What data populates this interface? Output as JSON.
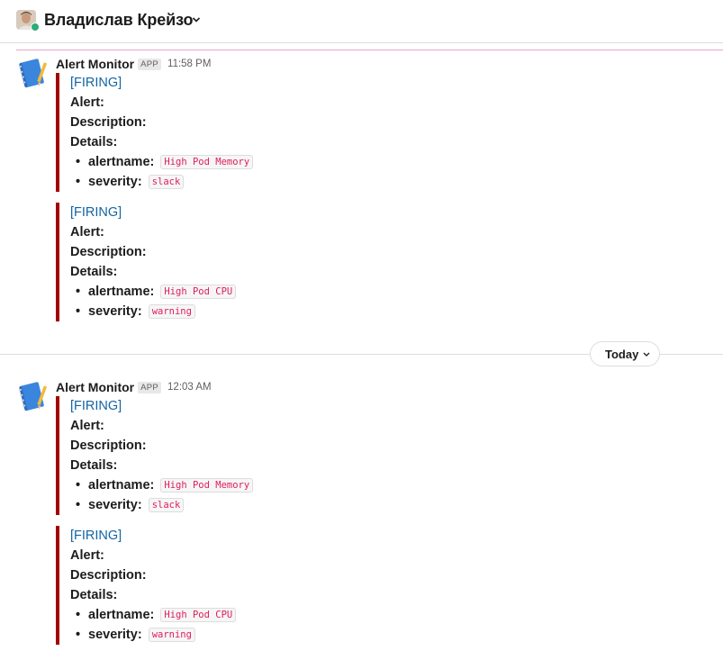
{
  "header": {
    "title": "Владислав Крейзо",
    "avatar_icon": "user-avatar",
    "chevron_icon": "chevron-down-icon"
  },
  "colors": {
    "attachment_bar": "#a30200",
    "firing_link": "#1264a3",
    "code_text": "#e01e5a",
    "presence": "#2bac76"
  },
  "day_divider": {
    "label": "Today"
  },
  "messages": [
    {
      "sender": "Alert Monitor",
      "badge": "APP",
      "time": "11:58 PM",
      "attachments": [
        {
          "title": "[FIRING]",
          "alert_label": "Alert:",
          "description_label": "Description:",
          "details_label": "Details:",
          "alertname_label": "alertname:",
          "alertname": "High Pod Memory",
          "severity_label": "severity:",
          "severity": "slack"
        },
        {
          "title": "[FIRING]",
          "alert_label": "Alert:",
          "description_label": "Description:",
          "details_label": "Details:",
          "alertname_label": "alertname:",
          "alertname": "High Pod CPU",
          "severity_label": "severity:",
          "severity": "warning"
        }
      ]
    },
    {
      "sender": "Alert Monitor",
      "badge": "APP",
      "time": "12:03 AM",
      "attachments": [
        {
          "title": "[FIRING]",
          "alert_label": "Alert:",
          "description_label": "Description:",
          "details_label": "Details:",
          "alertname_label": "alertname:",
          "alertname": "High Pod Memory",
          "severity_label": "severity:",
          "severity": "slack"
        },
        {
          "title": "[FIRING]",
          "alert_label": "Alert:",
          "description_label": "Description:",
          "details_label": "Details:",
          "alertname_label": "alertname:",
          "alertname": "High Pod CPU",
          "severity_label": "severity:",
          "severity": "warning"
        }
      ]
    }
  ]
}
